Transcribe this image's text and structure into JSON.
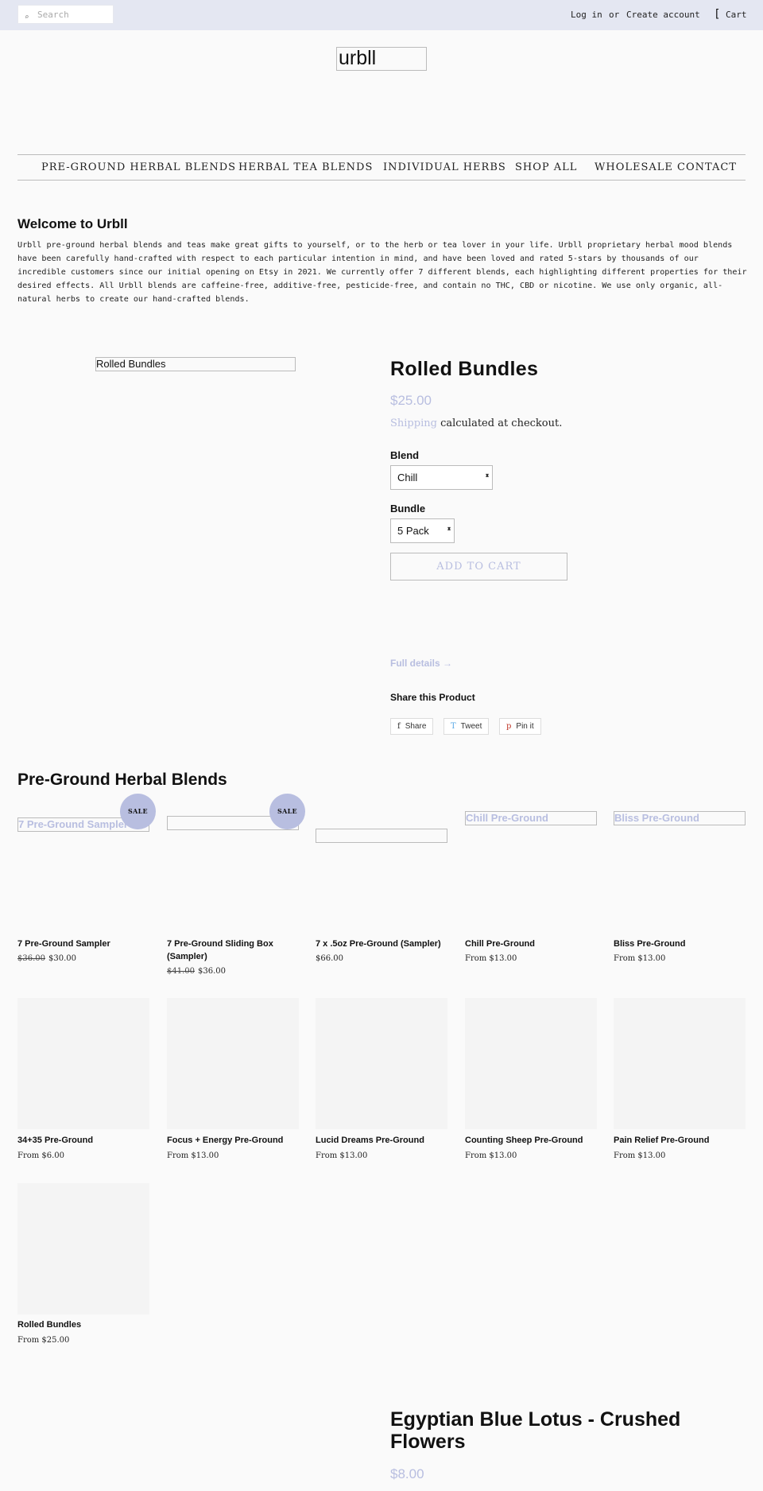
{
  "header": {
    "search_placeholder": "Search",
    "search_icon": "magnifier-icon",
    "login": "Log in",
    "or": "or",
    "create_account": "Create account",
    "cart_glyph": "[",
    "cart": "Cart"
  },
  "logo": {
    "text": "urbll"
  },
  "nav": {
    "items": [
      "PRE-GROUND HERBAL BLENDS",
      "HERBAL TEA BLENDS",
      "INDIVIDUAL HERBS",
      "SHOP ALL",
      "WHOLESALE CONTACT"
    ]
  },
  "welcome": {
    "title": "Welcome to Urbll",
    "body": "Urbll pre-ground herbal blends and teas make great gifts to yourself, or to the herb or tea lover in your life. Urbll proprietary herbal mood blends have been carefully hand-crafted with respect to each particular intention in mind, and have been loved and rated 5-stars by thousands of our incredible customers since our initial opening on Etsy in 2021. We currently offer 7 different blends, each highlighting different properties for their desired effects. All Urbll blends are caffeine-free, additive-free, pesticide-free, and contain no THC, CBD or nicotine. We use only organic, all-natural herbs to create our hand-crafted blends."
  },
  "featured": {
    "image_alt": "Rolled Bundles",
    "title": "Rolled Bundles",
    "price": "$25.00",
    "shipping_link": "Shipping",
    "shipping_text": "calculated at checkout.",
    "blend_label": "Blend",
    "blend_value": "Chill",
    "bundle_label": "Bundle",
    "bundle_value": "5 Pack",
    "add_to_cart": "ADD TO CART",
    "full_details": "Full details →",
    "share_title": "Share this Product",
    "share": {
      "glyph": "f",
      "label": "Share"
    },
    "tweet": {
      "glyph": "T",
      "label": "Tweet"
    },
    "pin": {
      "glyph": "p",
      "label": "Pin it"
    }
  },
  "collection": {
    "title": "Pre-Ground Herbal Blends",
    "sale_badge": "SALE",
    "row1": [
      {
        "alt": "7 Pre-Ground Sampler",
        "name": "7 Pre-Ground Sampler",
        "old_price": "$36.00",
        "price": "$30.00",
        "sale": true
      },
      {
        "alt": "",
        "name": "7 Pre-Ground Sliding Box (Sampler)",
        "old_price": "$41.00",
        "price": "$36.00",
        "sale": true
      },
      {
        "alt": "",
        "name": "7 x .5oz Pre-Ground (Sampler)",
        "old_price": "",
        "price": "$66.00",
        "sale": false
      },
      {
        "alt": "Chill Pre-Ground",
        "name": "Chill Pre-Ground",
        "old_price": "",
        "price": "From $13.00",
        "sale": false
      },
      {
        "alt": "Bliss Pre-Ground",
        "name": "Bliss Pre-Ground",
        "old_price": "",
        "price": "From $13.00",
        "sale": false
      }
    ],
    "row2": [
      {
        "name": "34+35 Pre-Ground",
        "price": "From $6.00"
      },
      {
        "name": "Focus + Energy Pre-Ground",
        "price": "From $13.00"
      },
      {
        "name": "Lucid Dreams Pre-Ground",
        "price": "From $13.00"
      },
      {
        "name": "Counting Sheep Pre-Ground",
        "price": "From $13.00"
      },
      {
        "name": "Pain Relief Pre-Ground",
        "price": "From $13.00"
      }
    ],
    "row3": [
      {
        "name": "Rolled Bundles",
        "price": "From $25.00"
      }
    ]
  },
  "featured2": {
    "title": "Egyptian Blue Lotus - Crushed Flowers",
    "price": "$8.00"
  }
}
